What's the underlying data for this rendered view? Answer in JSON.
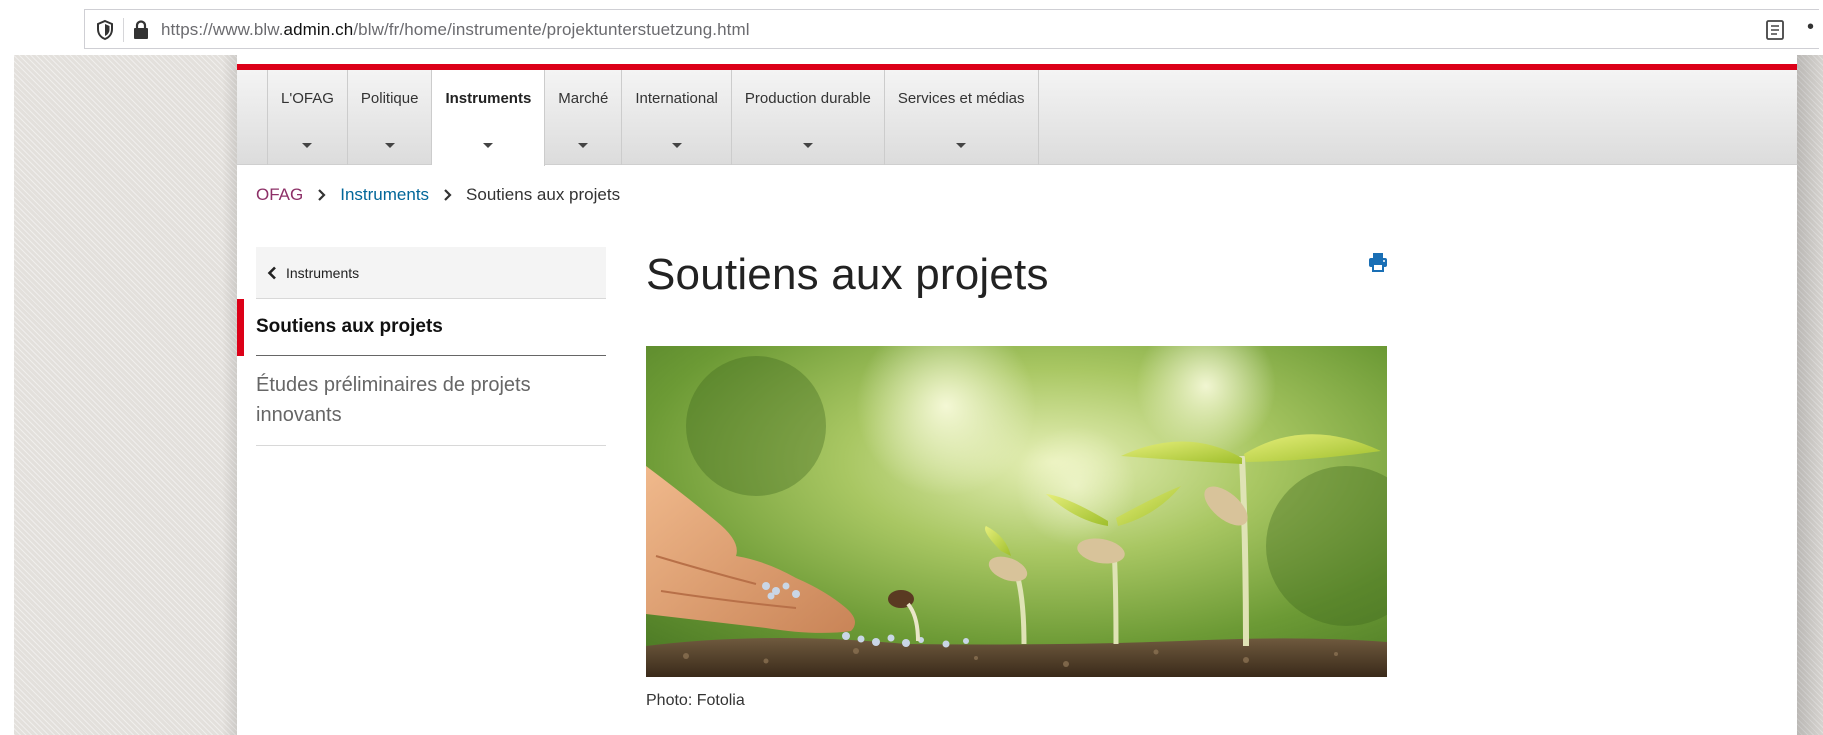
{
  "browser": {
    "url_prefix": "https://www.blw.",
    "url_domain": "admin.ch",
    "url_path": "/blw/fr/home/instrumente/projektunterstuetzung.html"
  },
  "nav": {
    "items": [
      {
        "label": "L'OFAG"
      },
      {
        "label": "Politique"
      },
      {
        "label": "Instruments"
      },
      {
        "label": "Marché"
      },
      {
        "label": "International"
      },
      {
        "label": "Production durable"
      },
      {
        "label": "Services et médias"
      }
    ],
    "active_index": 2
  },
  "breadcrumb": {
    "home": "OFAG",
    "parent": "Instruments",
    "current": "Soutiens aux projets"
  },
  "sidebar": {
    "back_label": "Instruments",
    "active_label": "Soutiens aux projets",
    "items": [
      {
        "label": "Études préliminaires de projets innovants"
      }
    ]
  },
  "main": {
    "title": "Soutiens aux projets",
    "image_caption": "Photo: Fotolia"
  },
  "colors": {
    "accent_red": "#dc0018",
    "link_blue": "#006699",
    "home_link": "#8d3067"
  }
}
